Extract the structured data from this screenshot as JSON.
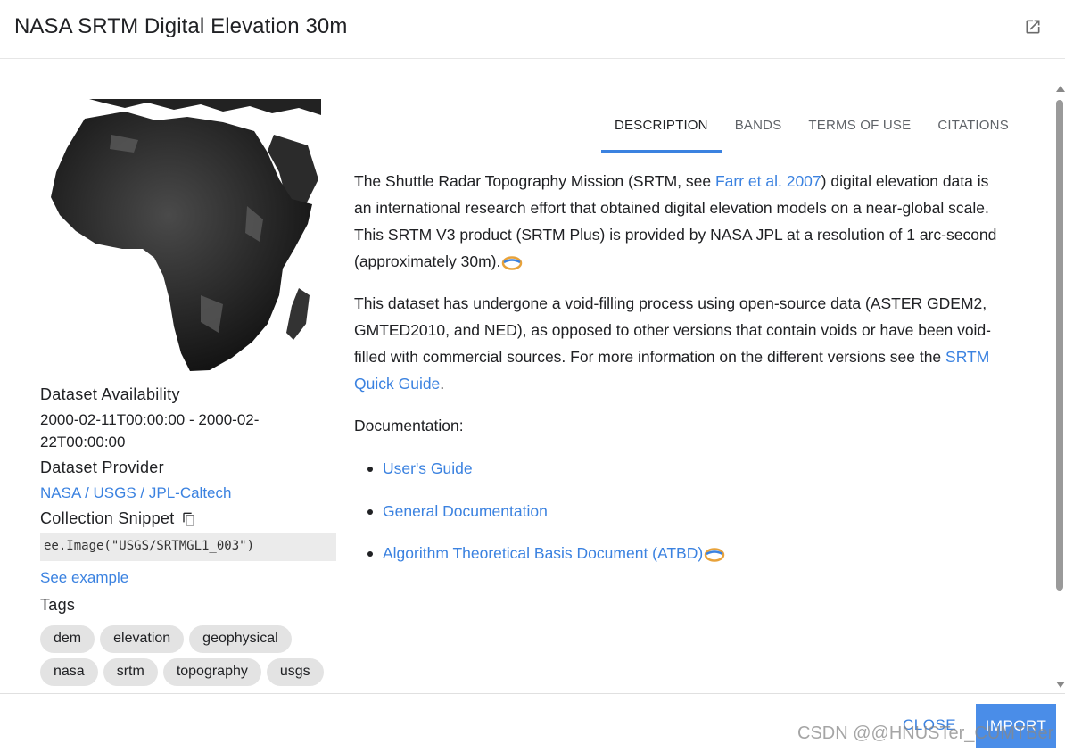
{
  "header": {
    "title": "NASA SRTM Digital Elevation 30m",
    "open_icon": "open-in-new-icon"
  },
  "sidebar": {
    "availability_heading": "Dataset Availability",
    "availability_line1": "2000-02-11T00:00:00 - 2000-02-",
    "availability_line2": "22T00:00:00",
    "provider_heading": "Dataset Provider",
    "provider_link": "NASA / USGS / JPL-Caltech",
    "snippet_heading": "Collection Snippet",
    "snippet_code": "ee.Image(\"USGS/SRTMGL1_003\")",
    "see_example": "See example",
    "tags_heading": "Tags",
    "tags": [
      "dem",
      "elevation",
      "geophysical",
      "nasa",
      "srtm",
      "topography",
      "usgs"
    ]
  },
  "tabs": [
    "DESCRIPTION",
    "BANDS",
    "TERMS OF USE",
    "CITATIONS"
  ],
  "description": {
    "p1_a": "The Shuttle Radar Topography Mission (SRTM, see ",
    "p1_link": "Farr et al. 2007",
    "p1_b": ") digital elevation data is an international research effort that obtained digital elevation models on a near-global scale. This SRTM V3 product (SRTM Plus) is provided by NASA JPL at a resolution of 1 arc-second (approximately 30m).",
    "p2_a": "This dataset has undergone a void-filling process using open-source data (ASTER GDEM2, GMTED2010, and NED), as opposed to other versions that contain voids or have been void-filled with commercial sources. For more information on the different versions see the ",
    "p2_link": "SRTM Quick Guide",
    "p2_b": ".",
    "doc_label": "Documentation:",
    "docs": [
      "User's Guide",
      "General Documentation",
      "Algorithm Theoretical Basis Document (ATBD)"
    ]
  },
  "footer": {
    "close": "CLOSE",
    "import": "IMPORT",
    "watermark": "CSDN @@HNUSTer_CUMTBer"
  },
  "colors": {
    "link": "#3b82e0",
    "primary_button": "#4a8de8"
  }
}
